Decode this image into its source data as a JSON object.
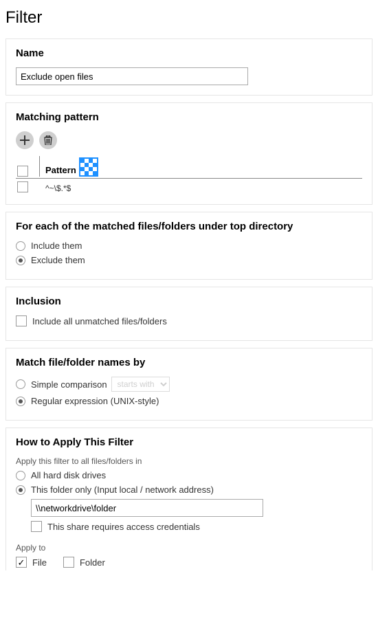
{
  "page": {
    "title": "Filter"
  },
  "name": {
    "panel_title": "Name",
    "value": "Exclude open files"
  },
  "pattern": {
    "panel_title": "Matching pattern",
    "header_label": "Pattern",
    "rows": [
      {
        "value": "^~\\$.*$"
      }
    ]
  },
  "matched_action": {
    "panel_title": "For each of the matched files/folders under top directory",
    "include_label": "Include them",
    "exclude_label": "Exclude them"
  },
  "inclusion": {
    "panel_title": "Inclusion",
    "checkbox_label": "Include all unmatched files/folders"
  },
  "match_by": {
    "panel_title": "Match file/folder names by",
    "simple_label": "Simple comparison",
    "simple_select": "starts with",
    "regex_label": "Regular expression (UNIX-style)"
  },
  "apply": {
    "panel_title": "How to Apply This Filter",
    "scope_prompt": "Apply this filter to all files/folders in",
    "all_drives_label": "All hard disk drives",
    "this_folder_label": "This folder only (Input local / network address)",
    "folder_value": "\\\\networkdrive\\folder",
    "credentials_label": "This share requires access credentials",
    "apply_to_label": "Apply to",
    "file_label": "File",
    "folder_label": "Folder"
  }
}
